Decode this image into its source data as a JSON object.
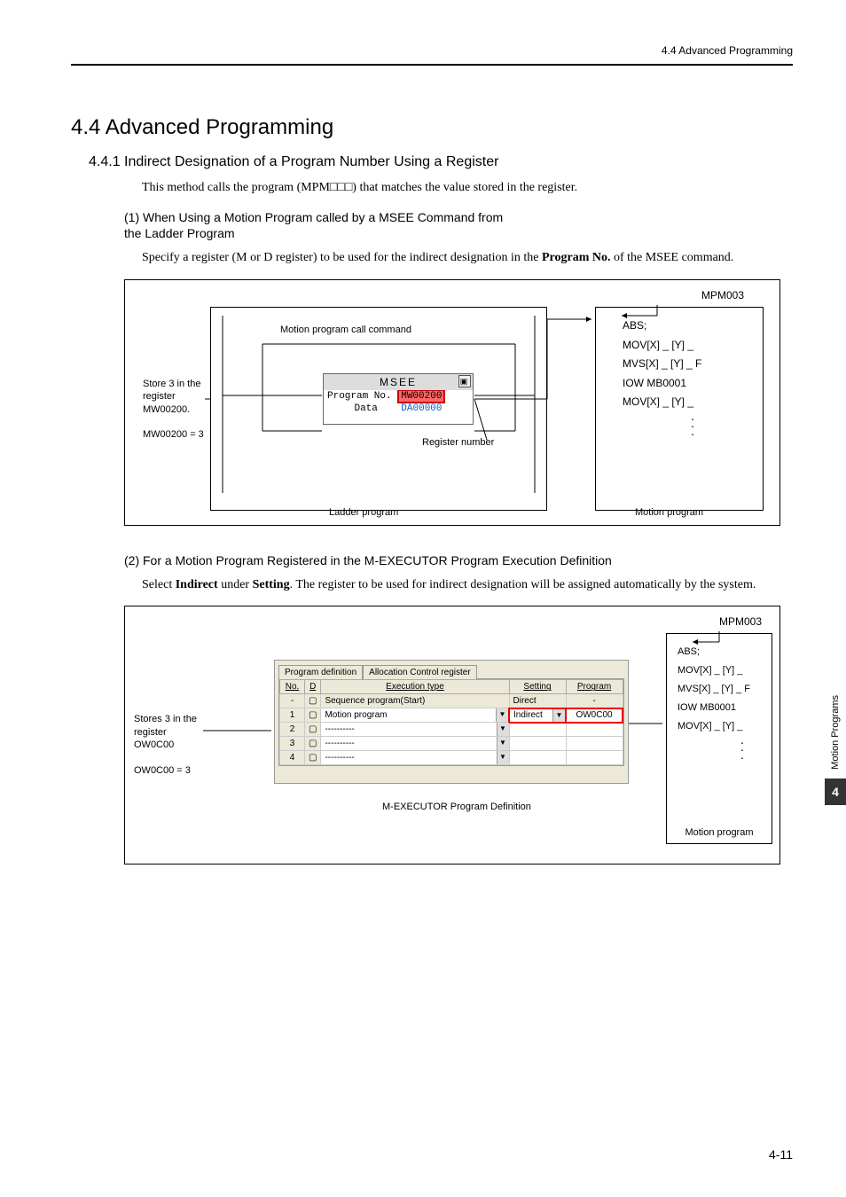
{
  "header": {
    "section_ref": "4.4  Advanced Programming"
  },
  "headings": {
    "h1": "4.4  Advanced Programming",
    "h2": "4.4.1  Indirect Designation of a Program Number Using a Register",
    "p1": "This method calls the program (MPM□□□) that matches the value stored in the register.",
    "h3a_l1": "(1) When Using a Motion Program called by a MSEE Command from",
    "h3a_l2": "the Ladder Program",
    "p2_a": "Specify a register (M or D register) to be used for the indirect designation in the ",
    "p2_b": "Program No.",
    "p2_c": " of the MSEE command.",
    "h3b": "(2) For a Motion Program Registered in the M-EXECUTOR Program Execution Definition",
    "p3_a": "Select ",
    "p3_b": "Indirect",
    "p3_c": " under ",
    "p3_d": "Setting",
    "p3_e": ". The register to be used for indirect designation will be assigned automatically by the system."
  },
  "fig1": {
    "mpm": "MPM003",
    "store_l1": "Store 3 in the register MW00200.",
    "store_l2": "MW00200 = 3",
    "callcmd": "Motion program call command",
    "regnum": "Register number",
    "ladderprog": "Ladder program",
    "motionprog": "Motion program",
    "msee_title": "MSEE",
    "msee_row1_label": "Program No.",
    "msee_row1_val": "MW00200",
    "msee_row2_label": "Data",
    "msee_row2_val": "DA00000",
    "code": [
      "ABS;",
      "MOV[X] _ [Y] _",
      "MVS[X] _ [Y] _ F",
      "IOW MB0001",
      "MOV[X] _ [Y] _"
    ]
  },
  "fig2": {
    "mpm": "MPM003",
    "store_l1": "Stores 3 in the register OW0C00",
    "store_l2": "OW0C00 = 3",
    "tab1": "Program definition",
    "tab2": "Allocation Control register",
    "cols": {
      "no": "No.",
      "d": "D",
      "exec": "Execution type",
      "setting": "Setting",
      "program": "Program"
    },
    "rows": [
      {
        "no": "-",
        "exec": "Sequence program(Start)",
        "setting": "Direct",
        "program": "-"
      },
      {
        "no": "1",
        "exec": "Motion program",
        "setting": "Indirect",
        "program": "OW0C00"
      },
      {
        "no": "2",
        "exec": "----------",
        "setting": "",
        "program": ""
      },
      {
        "no": "3",
        "exec": "----------",
        "setting": "",
        "program": ""
      },
      {
        "no": "4",
        "exec": "----------",
        "setting": "",
        "program": ""
      }
    ],
    "mex_label": "M-EXECUTOR Program Definition",
    "motionprog": "Motion program",
    "code": [
      "ABS;",
      "MOV[X] _ [Y] _",
      "MVS[X] _ [Y] _ F",
      "IOW MB0001",
      "MOV[X] _ [Y] _"
    ]
  },
  "side": {
    "label": "Motion Programs",
    "chapter": "4"
  },
  "pagenum": "4-11"
}
